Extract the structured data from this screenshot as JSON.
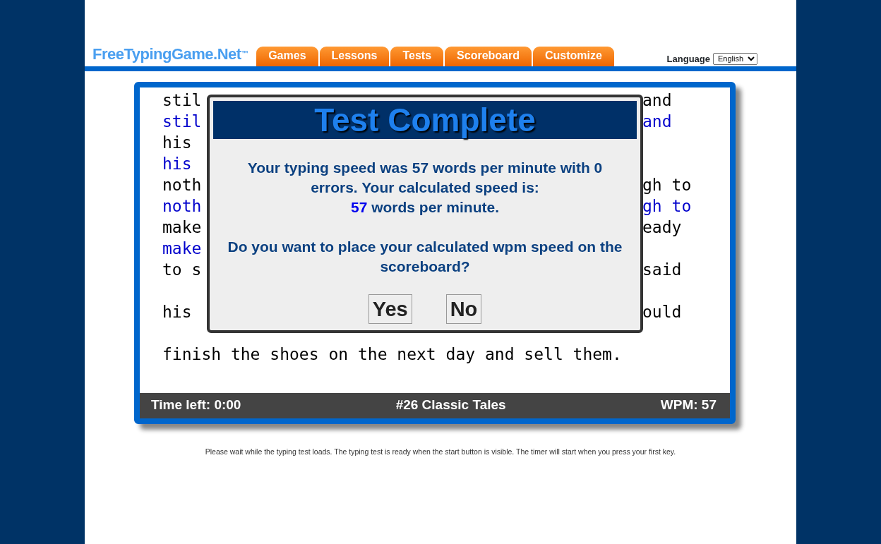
{
  "header": {
    "logo": "FreeTypingGame.Net$^{™}$",
    "tabs": [
      {
        "label": "Games"
      },
      {
        "label": "Lessons"
      },
      {
        "label": "Tests"
      },
      {
        "label": "Scoreboard"
      },
      {
        "label": "Customize"
      }
    ],
    "language": {
      "label": "Language",
      "value": "English"
    }
  },
  "passage": [
    {
      "kind": "source",
      "left": "stil",
      "right": "and"
    },
    {
      "kind": "typed",
      "left": "stil",
      "right": "and"
    },
    {
      "kind": "source",
      "left": "his"
    },
    {
      "kind": "typed",
      "left": "his"
    },
    {
      "kind": "source",
      "left": "noth",
      "right": "gh to"
    },
    {
      "kind": "typed",
      "left": "noth",
      "right": "gh to"
    },
    {
      "kind": "source",
      "left": "make",
      "right": "eady"
    },
    {
      "kind": "typed",
      "left": "make"
    },
    {
      "kind": "source",
      "left": "to s",
      "right": "said"
    },
    {
      "kind": "blank"
    },
    {
      "kind": "source",
      "left": "his",
      "right": "ould"
    },
    {
      "kind": "blank"
    },
    {
      "kind": "source",
      "left": "finish the shoes on the next day and sell them."
    }
  ],
  "status_bar": {
    "time_left": "Time left: 0:00",
    "test_name": "#26 Classic Tales",
    "wpm": "WPM: 57"
  },
  "dialog": {
    "title": "Test Complete",
    "message": "Your typing speed was 57 words per minute with 0 errors. Your calculated speed is:",
    "calculated_speed": "57",
    "speed_unit": "words per minute.",
    "question": "Do you want to place your calculated wpm speed on the scoreboard?",
    "buttons": [
      "Yes",
      "No"
    ]
  },
  "footer_note": "Please wait while the typing test loads. The typing test is ready when the start button is visible. The timer will start when you press your first key."
}
